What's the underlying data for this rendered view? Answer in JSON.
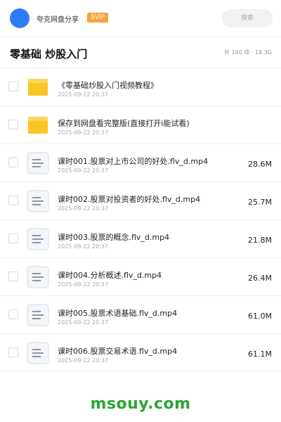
{
  "header": {
    "app_name": "夸克网盘分享",
    "badge": "SVIP",
    "search_label": "搜索"
  },
  "folder": {
    "title": "零基础 炒股入门",
    "summary": "共 160 项 · 18.3G"
  },
  "files": [
    {
      "type": "folder",
      "icon": "folder-icon",
      "name": "《零基础炒股入门视频教程》",
      "date": "2025-09-22 20:37",
      "size": ""
    },
    {
      "type": "folder",
      "icon": "folder-icon",
      "name": "保存到网盘看完整版(直接打开i能试看)",
      "date": "2025-09-22 20:37",
      "size": ""
    },
    {
      "type": "file",
      "icon": "file-icon",
      "name": "课时001.股票对上市公司的好处.flv_d.mp4",
      "date": "2025-09-22 20:37",
      "size": "28.6M"
    },
    {
      "type": "file",
      "icon": "file-icon",
      "name": "课时002.股票对投资者的好处.flv_d.mp4",
      "date": "2025-09-22 20:37",
      "size": "25.7M"
    },
    {
      "type": "file",
      "icon": "file-icon",
      "name": "课时003.股票的概念.flv_d.mp4",
      "date": "2025-09-22 20:37",
      "size": "21.8M"
    },
    {
      "type": "file",
      "icon": "file-icon",
      "name": "课时004.分析概述.flv_d.mp4",
      "date": "2025-09-22 20:37",
      "size": "26.4M"
    },
    {
      "type": "file",
      "icon": "file-icon",
      "name": "课时005.股票术语基础.flv_d.mp4",
      "date": "2025-09-22 20:37",
      "size": "61.0M"
    },
    {
      "type": "file",
      "icon": "file-icon",
      "name": "课时006.股票交易术语.flv_d.mp4",
      "date": "2025-09-22 20:37",
      "size": "61.1M"
    }
  ],
  "watermark": "msouy.com",
  "colors": {
    "avatar": "#2d7cf6",
    "badge": "#f7a43b",
    "folder": "#f9c625",
    "watermark": "#2aa531"
  }
}
